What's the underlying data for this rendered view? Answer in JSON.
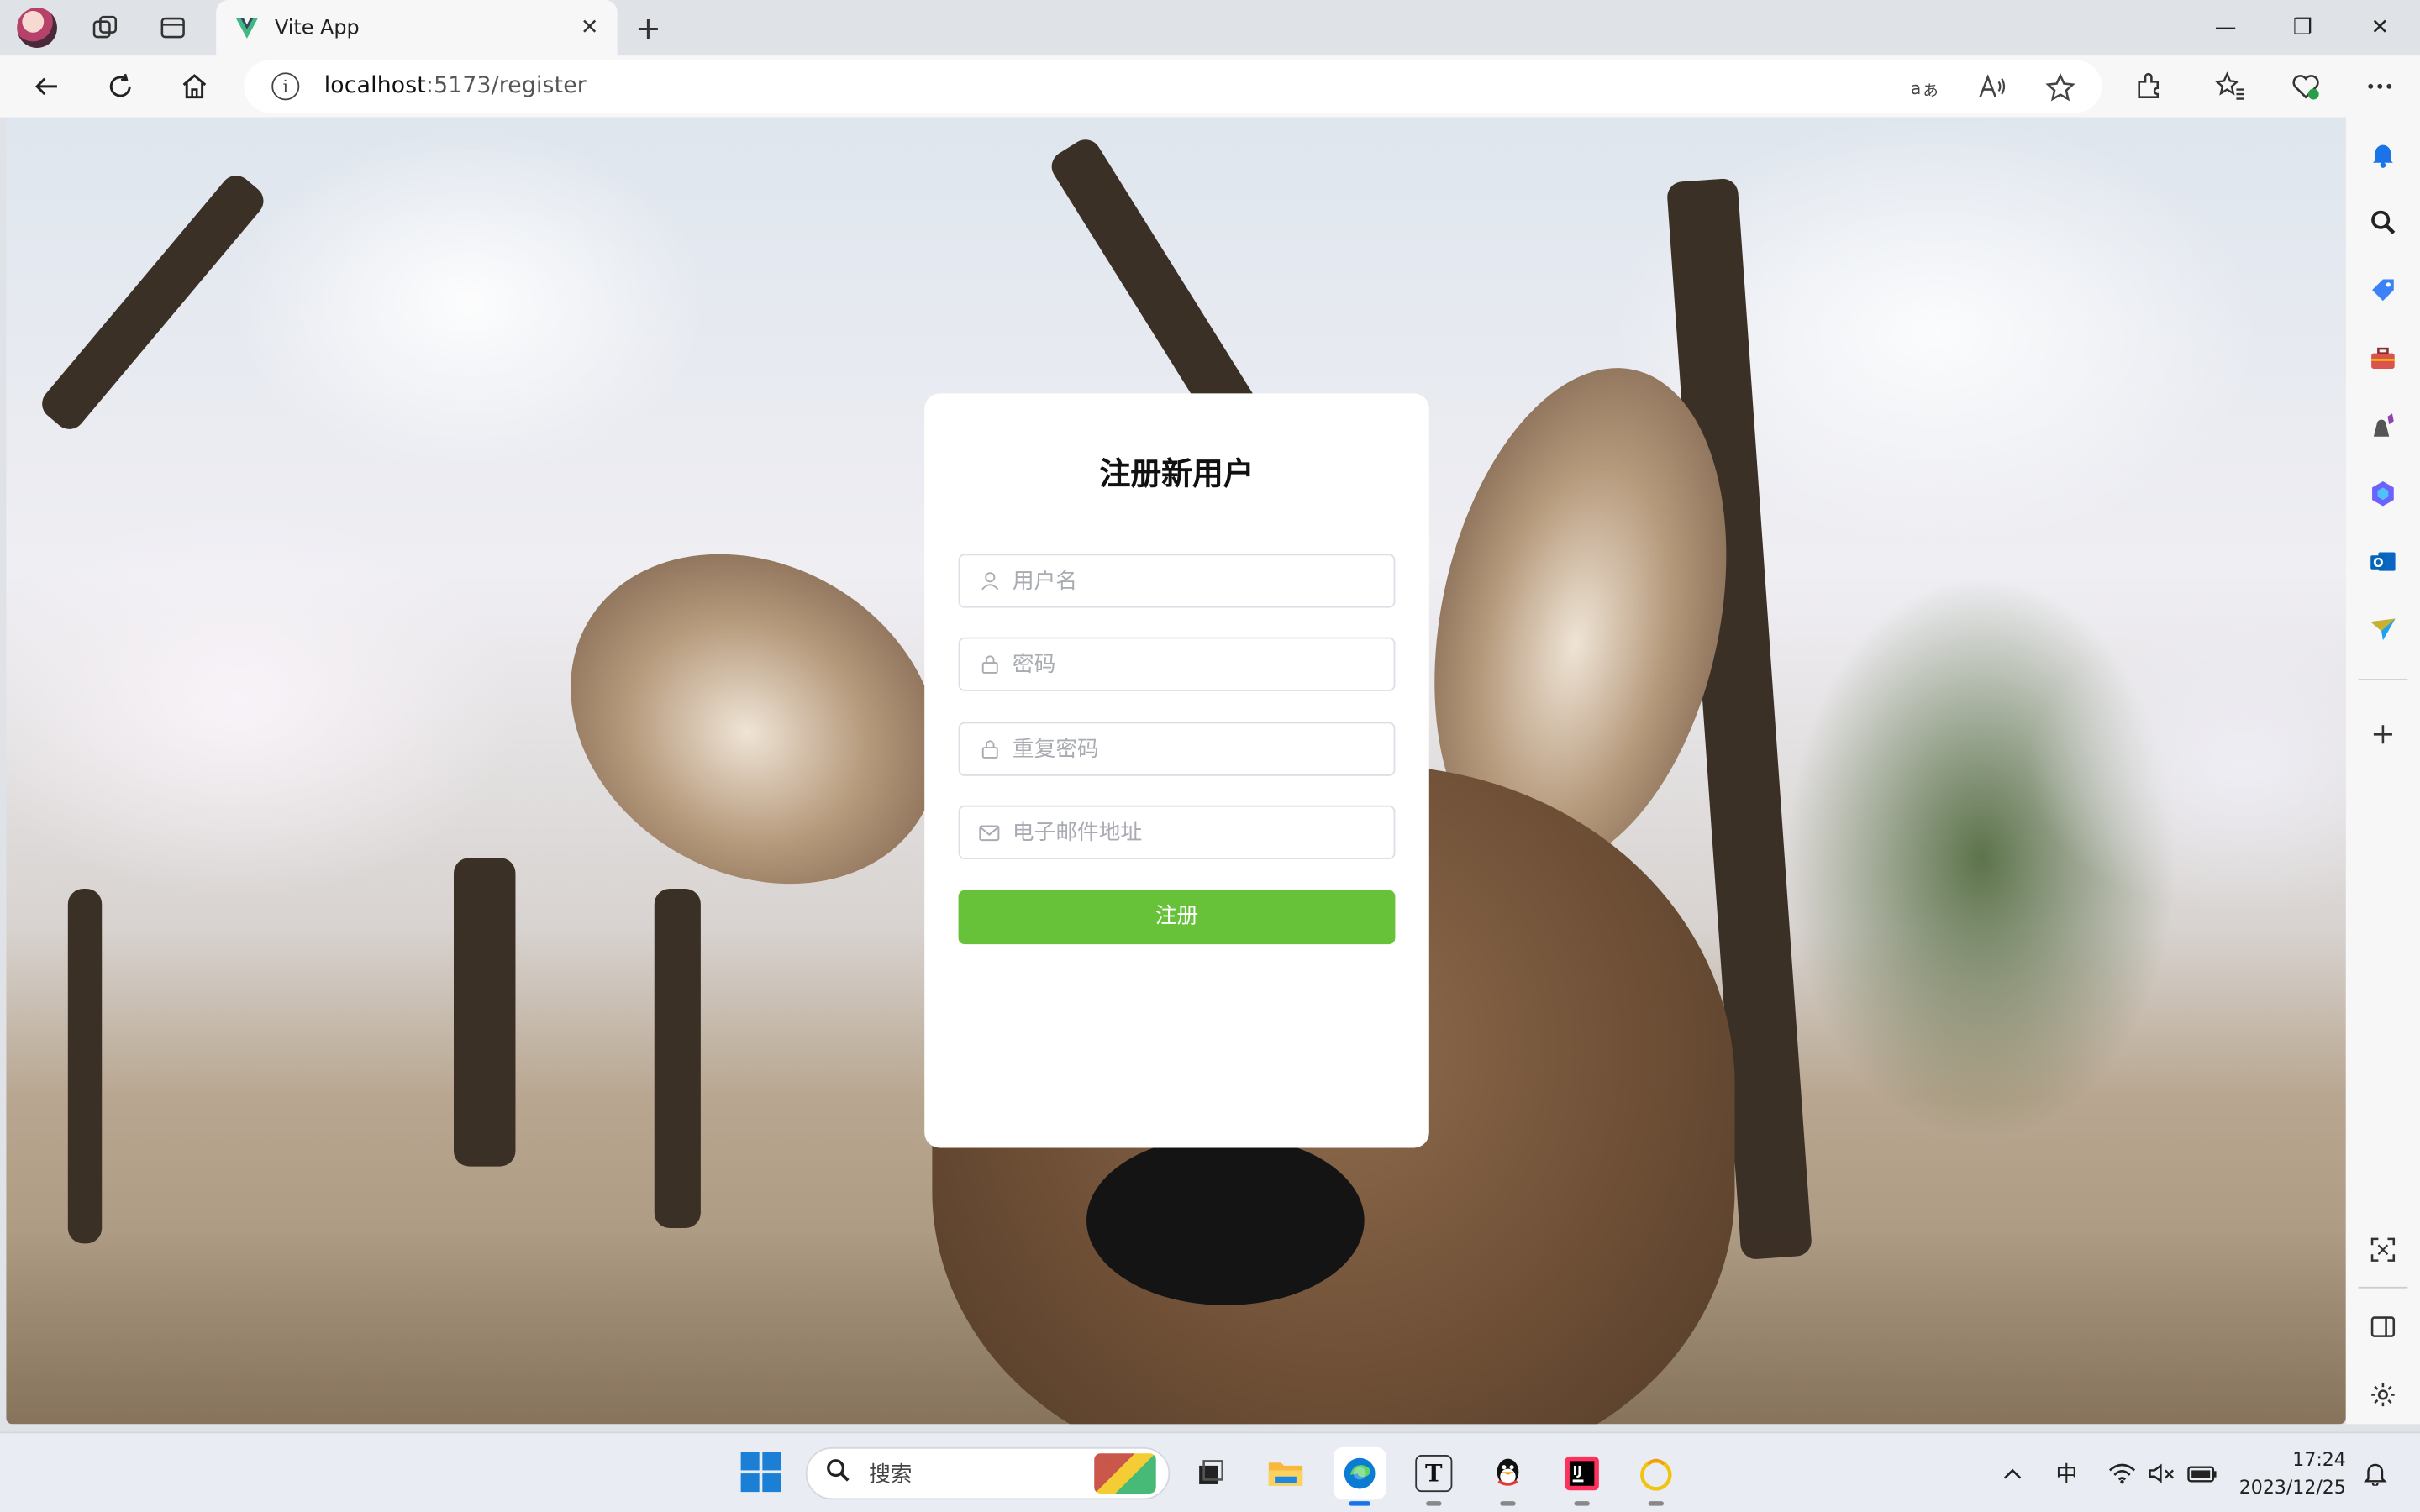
{
  "browser": {
    "tab": {
      "title": "Vite App",
      "close_glyph": "✕"
    },
    "new_tab_glyph": "+",
    "window_controls": {
      "minimize": "—",
      "restore": "❐",
      "close": "✕"
    },
    "url": {
      "host": "localhost",
      "path": ":5173/register"
    },
    "omnibox_icons": [
      "translate-icon",
      "read-aloud-icon",
      "favorite-star-icon"
    ],
    "toolbar_icons": [
      "extensions-icon",
      "favorites-icon",
      "browser-essentials-icon",
      "more-icon"
    ]
  },
  "register": {
    "title": "注册新用户",
    "username_placeholder": "用户名",
    "password_placeholder": "密码",
    "confirm_password_placeholder": "重复密码",
    "email_placeholder": "电子邮件地址",
    "submit_label": "注册",
    "accent_color": "#67c23a"
  },
  "sidebar": {
    "icons": [
      "bell-icon",
      "search-icon",
      "tag-icon",
      "toolbox-icon",
      "games-icon",
      "copilot-icon",
      "outlook-icon",
      "send-icon",
      "add-icon",
      "screenshot-icon",
      "split-screen-icon",
      "settings-icon"
    ]
  },
  "taskbar": {
    "search_label": "搜索",
    "ime_label": "中",
    "time": "17:24",
    "date": "2023/12/25"
  }
}
